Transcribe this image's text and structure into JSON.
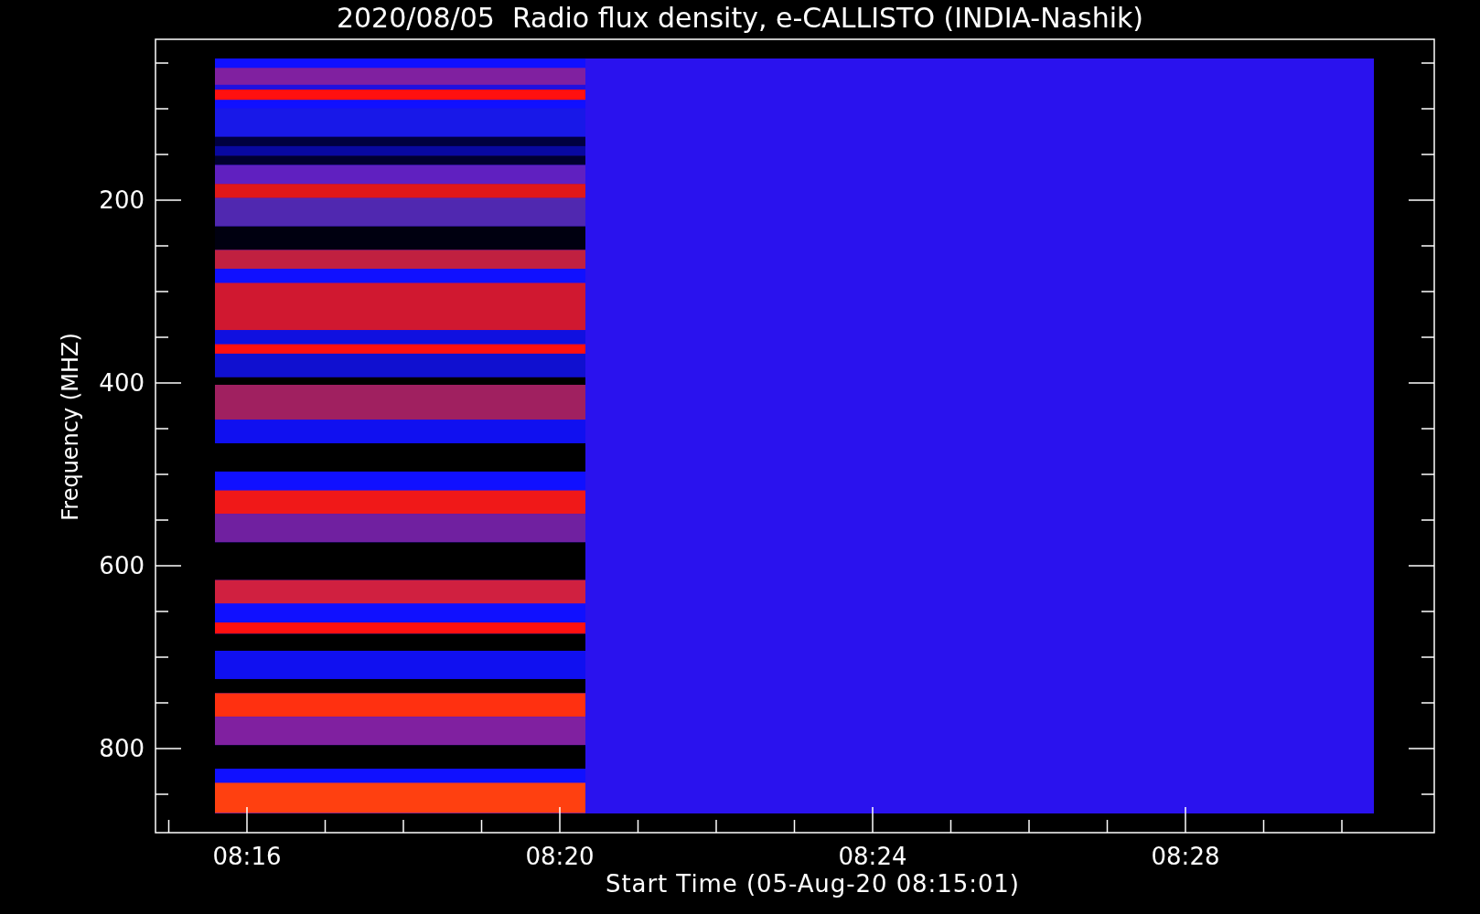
{
  "plot": {
    "title": "2020/08/05  Radio flux density, e-CALLISTO (INDIA-Nashik)",
    "x_axis": {
      "label": "Start Time (05-Aug-20 08:15:01)",
      "ticks": [
        "08:16",
        "08:20",
        "08:24",
        "08:28"
      ]
    },
    "y_axis": {
      "label": "Frequency (MHZ)",
      "ticks": [
        "200",
        "400",
        "600",
        "800"
      ]
    }
  }
}
